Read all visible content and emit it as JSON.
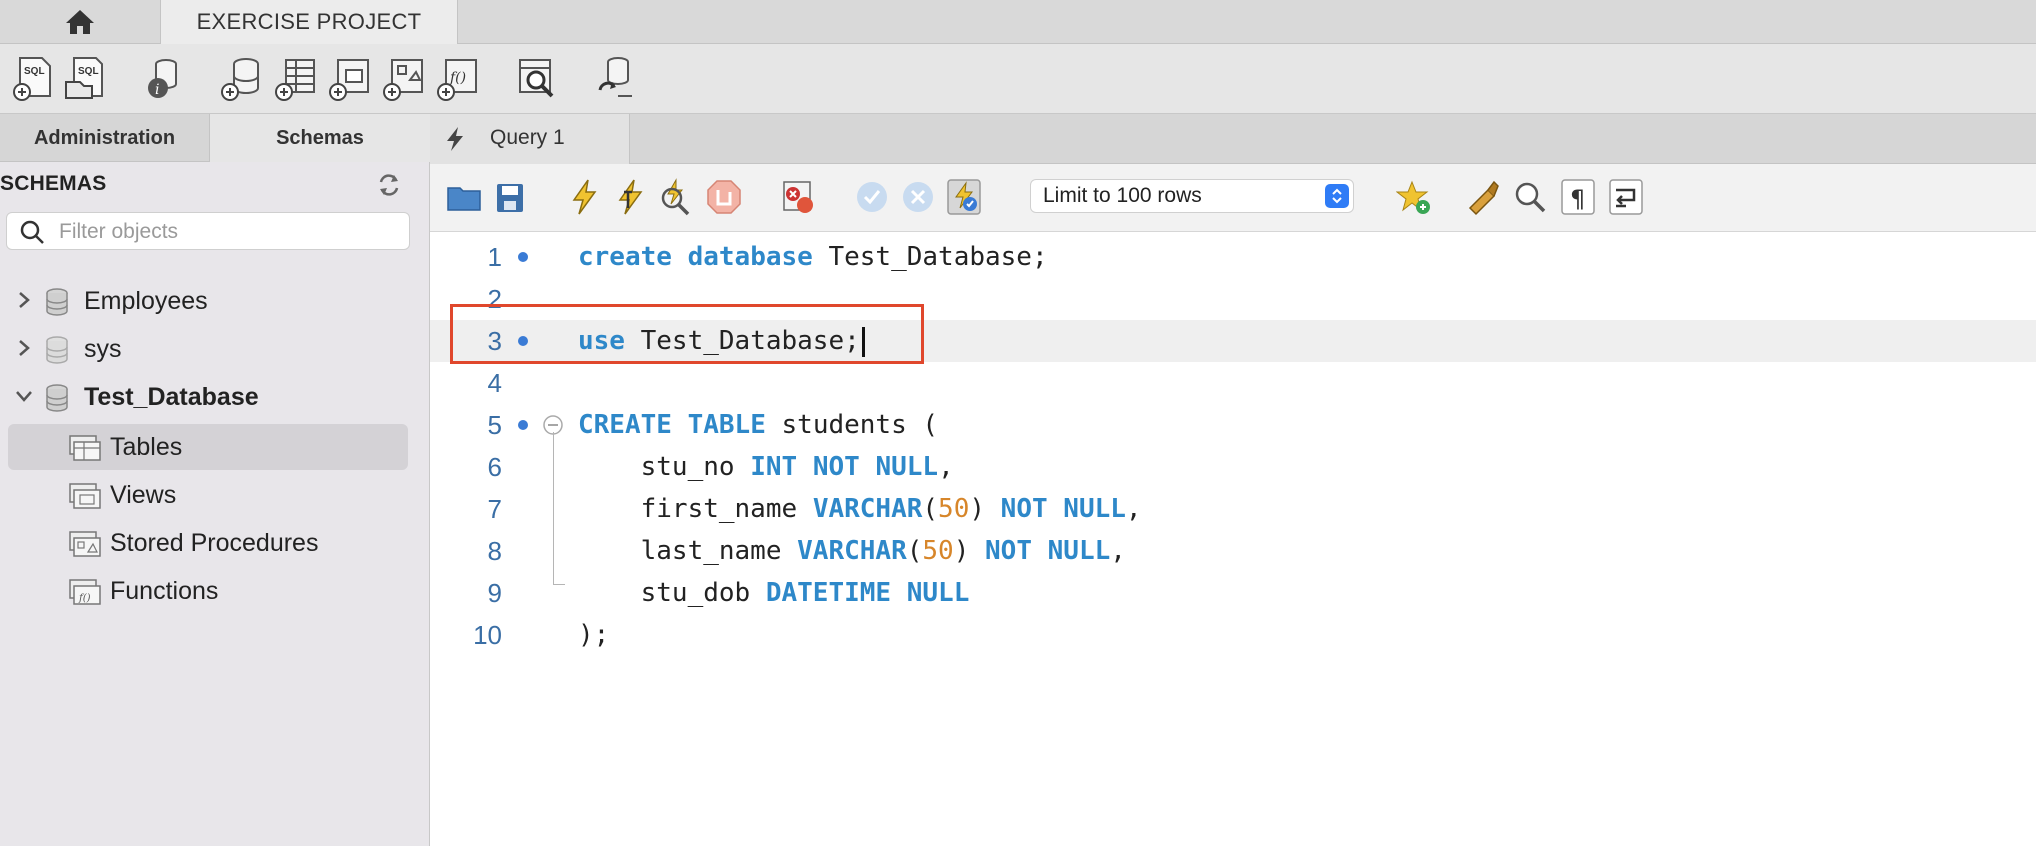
{
  "window": {
    "home_tab_icon": "home-icon",
    "project_tab": "EXERCISE PROJECT"
  },
  "main_toolbar": {
    "icons": [
      "new-sql-tab-icon",
      "open-sql-script-icon",
      "server-info-icon",
      "create-schema-icon",
      "create-table-icon",
      "create-view-icon",
      "create-procedure-icon",
      "create-function-icon",
      "search-table-data-icon",
      "reconnect-icon"
    ]
  },
  "left_panel": {
    "tabs": [
      "Administration",
      "Schemas"
    ],
    "schemas_header": "SCHEMAS",
    "filter_placeholder": "Filter objects",
    "tree": [
      {
        "label": "Employees",
        "expanded": false
      },
      {
        "label": "sys",
        "expanded": false
      },
      {
        "label": "Test_Database",
        "expanded": true,
        "children": [
          "Tables",
          "Views",
          "Stored Procedures",
          "Functions"
        ]
      }
    ],
    "selected_child": "Tables"
  },
  "editor": {
    "tab": "Query 1",
    "limit_select": "Limit to 100 rows",
    "line_numbers": [
      "1",
      "2",
      "3",
      "4",
      "5",
      "6",
      "7",
      "8",
      "9",
      "10"
    ],
    "colors": {
      "keyword": "#2e88c9",
      "number": "#d7862a",
      "highlight_box": "#e0472c"
    }
  }
}
